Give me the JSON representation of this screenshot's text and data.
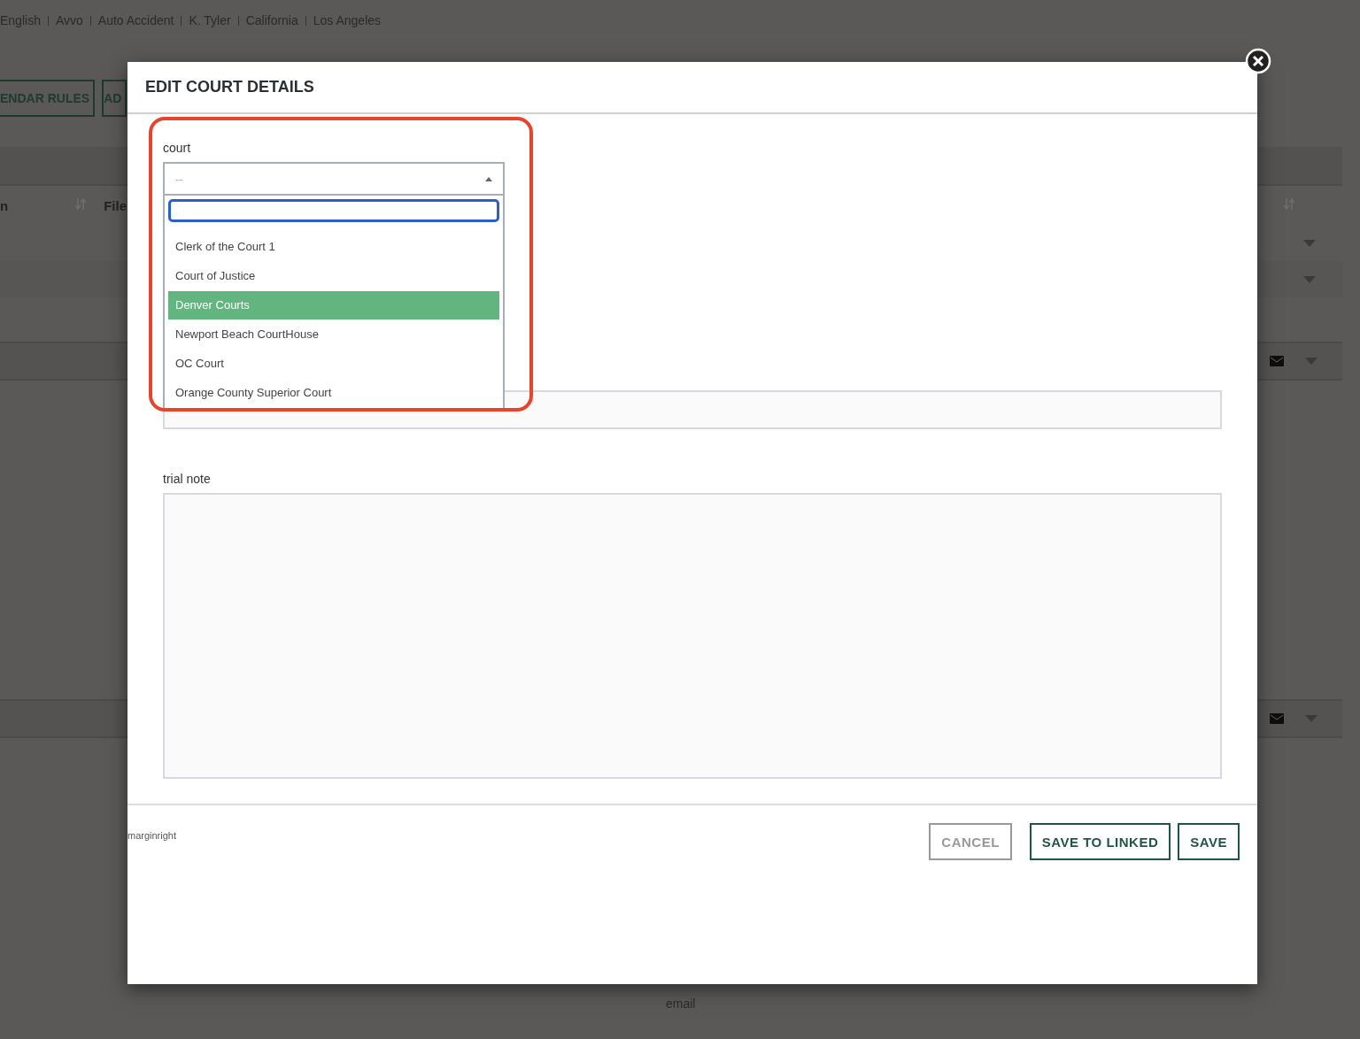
{
  "background": {
    "breadcrumbs": [
      "English",
      "Avvo",
      "Auto Accident",
      "K. Tyler",
      "California",
      "Los Angeles"
    ],
    "toolbar_buttons": [
      "ENDAR RULES",
      "AD"
    ],
    "table_columns": [
      "n",
      "File"
    ],
    "footer_label": "email"
  },
  "dialog": {
    "title": "EDIT COURT DETAILS",
    "court": {
      "label": "court",
      "placeholder": "--",
      "expanded": true,
      "options": [
        {
          "label": "Clerk of the Court 1",
          "selected": false
        },
        {
          "label": "Court of Justice",
          "selected": false
        },
        {
          "label": "Denver Courts",
          "selected": true
        },
        {
          "label": "Newport Beach CourtHouse",
          "selected": false
        },
        {
          "label": "OC Court",
          "selected": false
        },
        {
          "label": "Orange County Superior Court",
          "selected": false
        }
      ]
    },
    "trial_note": {
      "label": "trial note"
    },
    "footer_note": "marginright",
    "buttons": [
      {
        "label": "CANCEL",
        "kind": "secondary"
      },
      {
        "label": "SAVE TO LINKED",
        "kind": "primary"
      },
      {
        "label": "SAVE",
        "kind": "primary"
      }
    ]
  }
}
